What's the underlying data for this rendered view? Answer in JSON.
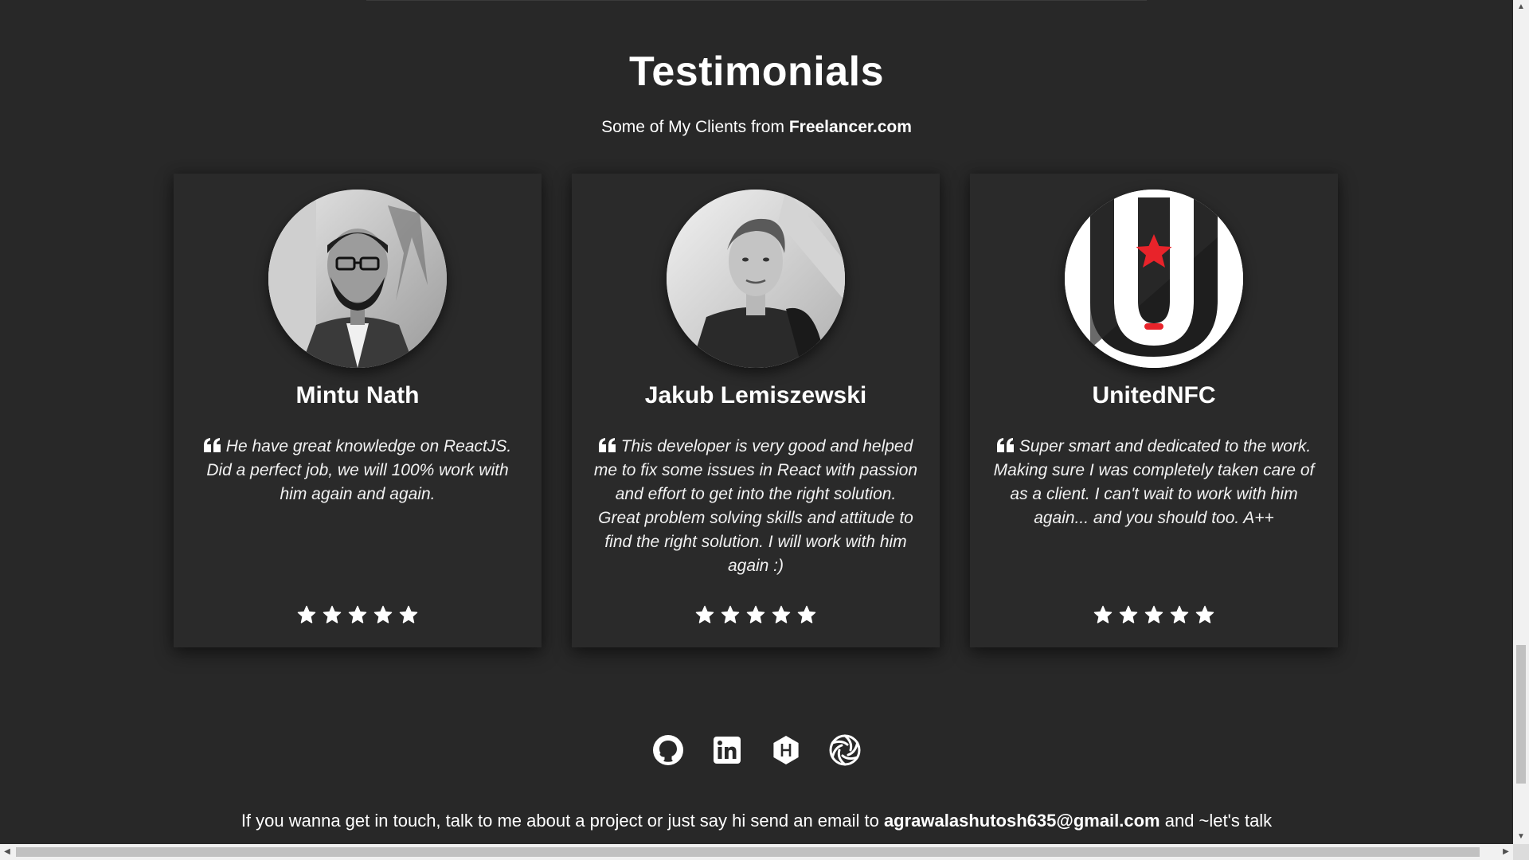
{
  "section": {
    "title": "Testimonials",
    "subtitle_prefix": "Some of My Clients from ",
    "subtitle_strong": "Freelancer.com"
  },
  "testimonials": [
    {
      "name": "Mintu Nath",
      "quote": "He have great knowledge on ReactJS. Did a perfect job, we will 100% work with him again and again.",
      "rating": 5
    },
    {
      "name": "Jakub Lemiszewski",
      "quote": "This developer is very good and helped me to fix some issues in React with passion and effort to get into the right solution. Great problem solving skills and attitude to find the right solution. I will work with him again :)",
      "rating": 5
    },
    {
      "name": "UnitedNFC",
      "quote": "Super smart and dedicated to the work. Making sure I was completely taken care of as a client. I can't wait to work with him again... and you should too. A++",
      "rating": 5
    }
  ],
  "socials": [
    {
      "icon": "github-icon"
    },
    {
      "icon": "linkedin-icon"
    },
    {
      "icon": "hashnode-icon"
    },
    {
      "icon": "codepen-aperture-icon"
    }
  ],
  "contact": {
    "prefix": "If you wanna get in touch, talk to me about a project or just say hi send an email to ",
    "email": "agrawalashutosh635@gmail.com",
    "suffix": " and ~let's talk"
  },
  "colors": {
    "background": "#282828",
    "card": "#2a2a2a",
    "text": "#ffffff",
    "accent_red": "#e8232a"
  }
}
